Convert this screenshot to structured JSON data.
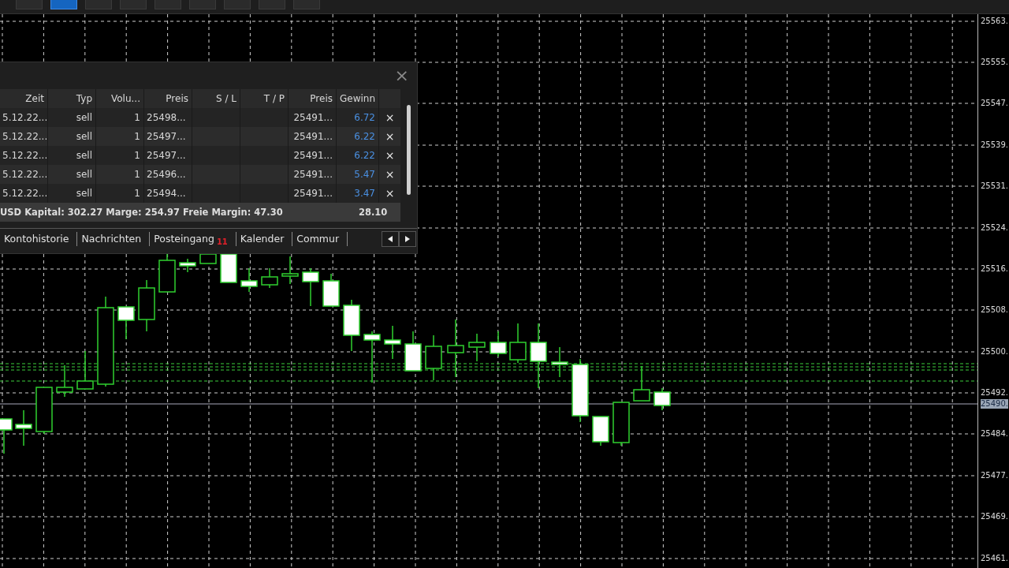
{
  "timeframes": [
    {
      "selected": false
    },
    {
      "selected": true
    },
    {
      "selected": false
    },
    {
      "selected": false
    },
    {
      "selected": false
    },
    {
      "selected": false
    },
    {
      "selected": false
    },
    {
      "selected": false
    },
    {
      "selected": false
    }
  ],
  "price_axis": {
    "labels": [
      "25563.",
      "25555.",
      "25547.",
      "25539.",
      "25531.",
      "25524.",
      "25516.",
      "25508.",
      "25500.",
      "25492.",
      "25484.",
      "25477.",
      "25469.",
      "25461."
    ],
    "current": "25490."
  },
  "trade_panel": {
    "close": "×",
    "columns": [
      "Zeit",
      "Typ",
      "Volu...",
      "Preis",
      "S / L",
      "T / P",
      "Preis",
      "Gewinn"
    ],
    "rows": [
      {
        "cells": [
          "5.12.22...",
          "sell",
          "1",
          "25498...",
          "",
          "",
          "25491...",
          "6.72"
        ],
        "close": "×"
      },
      {
        "cells": [
          "5.12.22...",
          "sell",
          "1",
          "25497...",
          "",
          "",
          "25491...",
          "6.22"
        ],
        "close": "×"
      },
      {
        "cells": [
          "5.12.22...",
          "sell",
          "1",
          "25497...",
          "",
          "",
          "25491...",
          "6.22"
        ],
        "close": "×"
      },
      {
        "cells": [
          "5.12.22...",
          "sell",
          "1",
          "25496...",
          "",
          "",
          "25491...",
          "5.47"
        ],
        "close": "×"
      },
      {
        "cells": [
          "5.12.22...",
          "sell",
          "1",
          "25494...",
          "",
          "",
          "25491...",
          "3.47"
        ],
        "close": "×"
      }
    ],
    "summary": {
      "text": "USD  Kapital: 302.27  Marge: 254.97  Freie Margin: 47.30",
      "total": "28.10"
    },
    "tabs": [
      {
        "label": "Kontohistorie",
        "selected": false
      },
      {
        "label": "Nachrichten",
        "selected": false
      },
      {
        "label": "Posteingang",
        "badge": "11",
        "selected": false
      },
      {
        "label": "Kalender",
        "selected": false
      },
      {
        "label": "Commur",
        "selected": false
      }
    ]
  }
}
